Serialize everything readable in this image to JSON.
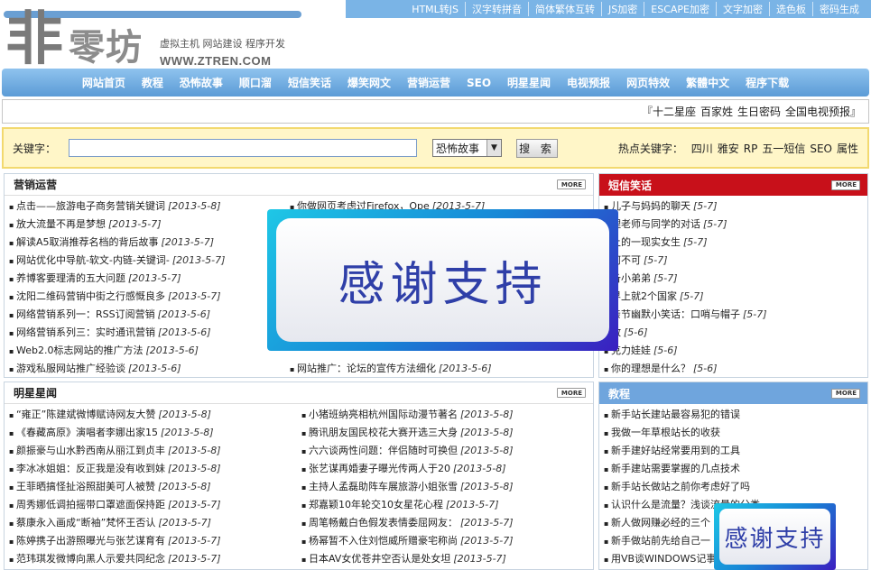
{
  "topbar": [
    "HTML转JS",
    "汉字转拼音",
    "简体繁体互转",
    "JS加密",
    "ESCAPE加密",
    "文字加密",
    "选色板",
    "密码生成"
  ],
  "logo": {
    "char": "非",
    "name": "零坊",
    "slogan": "虚拟主机 网站建设 程序开发",
    "url": "WWW.ZTREN.COM"
  },
  "nav": [
    "网站首页",
    "教程",
    "恐怖故事",
    "顺口溜",
    "短信笑话",
    "爆笑网文",
    "营销运营",
    "SEO",
    "明星星闻",
    "电视预报",
    "网页特效",
    "繁體中文",
    "程序下载"
  ],
  "hotlinks": [
    "『十二星座",
    "百家姓",
    "生日密码",
    "全国电视预报』"
  ],
  "search": {
    "label": "关键字：",
    "value": "",
    "select": "恐怖故事",
    "button": "搜 索",
    "hot_label": "热点关键字：",
    "hot": [
      "四川",
      "雅安",
      "RP",
      "五一短信",
      "SEO",
      "属性"
    ]
  },
  "more": "MORE",
  "marketing": {
    "title": "营销运营",
    "left": [
      {
        "t": "点击——旅游电子商务营销关键词",
        "d": "[2013-5-8]"
      },
      {
        "t": "放大流量不再是梦想",
        "d": "[2013-5-7]"
      },
      {
        "t": "解读A5取消推荐名档的背后故事",
        "d": "[2013-5-7]"
      },
      {
        "t": "网站优化中导航-软文-内链-关键词-",
        "d": "[2013-5-7]"
      },
      {
        "t": "养博客要理清的五大问题",
        "d": "[2013-5-7]"
      },
      {
        "t": "沈阳二维码营销中街之行感慨良多",
        "d": "[2013-5-7]"
      },
      {
        "t": "网络营销系列一：RSS订阅营销",
        "d": "[2013-5-6]"
      },
      {
        "t": "网络营销系列三：实时通讯营销",
        "d": "[2013-5-6]"
      },
      {
        "t": "Web2.0标志网站的推广方法",
        "d": "[2013-5-6]"
      },
      {
        "t": "游戏私服网站推广经验谈",
        "d": "[2013-5-6]"
      }
    ],
    "right": [
      {
        "t": "你做网页考虑过Firefox，Ope",
        "d": "[2013-5-7]"
      },
      {
        "t": "网站推广：论坛的宣传方法细化",
        "d": "[2013-5-6]"
      }
    ]
  },
  "jokes": {
    "title": "短信笑话",
    "items": [
      {
        "t": "儿子与妈妈的聊天",
        "d": "[5-7]"
      },
      {
        "t": "理老师与同学的对话",
        "d": "[5-7]"
      },
      {
        "t": "上的一现实女生",
        "d": "[5-7]"
      },
      {
        "t": "何不可",
        "d": "[5-7]"
      },
      {
        "t": "备小弟弟",
        "d": "[5-7]"
      },
      {
        "t": "界上就2个国家",
        "d": "[5-7]"
      },
      {
        "t": "亲节幽默小笑话：口哨与帽子",
        "d": "[5-7]"
      },
      {
        "t": "敢",
        "d": "[5-6]"
      },
      {
        "t": "克力娃娃",
        "d": "[5-6]"
      },
      {
        "t": "你的理想是什么？",
        "d": "[5-6]"
      }
    ]
  },
  "stars": {
    "title": "明星星闻",
    "left": [
      {
        "t": "“雍正”陈建斌微博赋诗网友大赞",
        "d": "[2013-5-8]"
      },
      {
        "t": "《春藏高原》演唱者李娜出家15",
        "d": "[2013-5-8]"
      },
      {
        "t": "颜振豪与山水黔西南从丽江到贞丰",
        "d": "[2013-5-8]"
      },
      {
        "t": "李冰冰姐姐：反正我是没有收到妹",
        "d": "[2013-5-8]"
      },
      {
        "t": "王菲晒搞怪扯浴照甜美可人被赞",
        "d": "[2013-5-8]"
      },
      {
        "t": "周秀娜低调拍摇带口罩遮面保持距",
        "d": "[2013-5-7]"
      },
      {
        "t": "蔡康永入画成“断袖”梵怀王否认",
        "d": "[2013-5-7]"
      },
      {
        "t": "陈婷携子出游照曝光与张艺谋育有",
        "d": "[2013-5-7]"
      },
      {
        "t": "范玮琪发微博向黑人示爱共同纪念",
        "d": "[2013-5-7]"
      }
    ],
    "right": [
      {
        "t": "小猪班纳亮相杭州国际动漫节著名",
        "d": "[2013-5-8]"
      },
      {
        "t": "腾讯朋友国民校花大赛开选三大身",
        "d": "[2013-5-8]"
      },
      {
        "t": "六六谈两性问题：伴侣随时可换但",
        "d": "[2013-5-8]"
      },
      {
        "t": "张艺谋再婚妻子曝光传两人于20",
        "d": "[2013-5-8]"
      },
      {
        "t": "主持人孟磊助阵车展旅游小姐张雪",
        "d": "[2013-5-8]"
      },
      {
        "t": "郑嘉颖10年轮交10女星花心程",
        "d": "[2013-5-7]"
      },
      {
        "t": "周笔畅戴白色假发表情委屈网友：",
        "d": "[2013-5-7]"
      },
      {
        "t": "杨幂暂不入住刘恺威所赠豪宅称尚",
        "d": "[2013-5-7]"
      },
      {
        "t": "日本AV女优苍井空否认是处女坦",
        "d": "[2013-5-7]"
      }
    ]
  },
  "tutorial": {
    "title": "教程",
    "items": [
      {
        "t": "新手站长建站最容易犯的错误",
        "d": ""
      },
      {
        "t": "我做一年草根站长的收获",
        "d": ""
      },
      {
        "t": "新手建好站经常要用到的工具",
        "d": ""
      },
      {
        "t": "新手建站需要掌握的几点技术",
        "d": ""
      },
      {
        "t": "新手站长做站之前你考虑好了吗",
        "d": ""
      },
      {
        "t": "认识什么是流量？浅谈流量的分类",
        "d": ""
      },
      {
        "t": "新人做网赚必经的三个",
        "d": ""
      },
      {
        "t": "新手做站前先给自己一",
        "d": ""
      },
      {
        "t": "用VB谈WINDOWS记事本",
        "d": ""
      }
    ]
  },
  "popup": {
    "text": "感谢支持"
  },
  "popup_small": {
    "text": "感谢支持"
  }
}
